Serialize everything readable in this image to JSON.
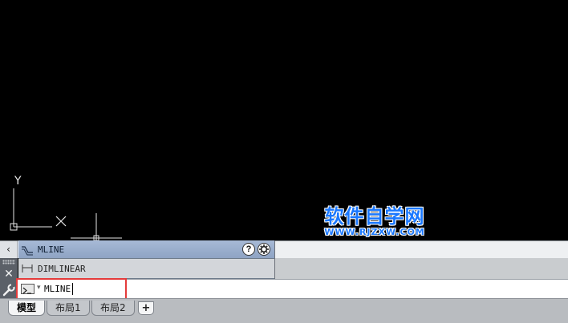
{
  "canvas": {
    "ucs_y_label": "Y",
    "background": "#000000"
  },
  "watermark": {
    "main_text": "软件自学网",
    "sub_text": "WWW.RJZXW.COM",
    "color": "#1a78ff"
  },
  "scroll": {
    "left_arrow_icon": "‹"
  },
  "command_history": {
    "items": [
      {
        "icon": "mline-icon",
        "label": "MLINE"
      },
      {
        "icon": "dimlinear-icon",
        "label": "DIMLINEAR"
      }
    ],
    "help_label": "?"
  },
  "side_bar": {
    "close_icon": "✕"
  },
  "command_line": {
    "prompt_caret": "▾",
    "value": "MLINE",
    "highlight_color": "#e43b3b"
  },
  "layout_tabs": {
    "tabs": [
      {
        "label": "模型",
        "active": true
      },
      {
        "label": "布局1",
        "active": false
      },
      {
        "label": "布局2",
        "active": false
      }
    ],
    "add_label": "+"
  }
}
